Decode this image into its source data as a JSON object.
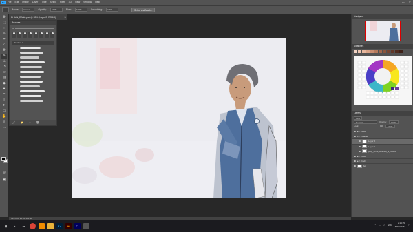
{
  "app": {
    "logo": "Ps",
    "menu": [
      "File",
      "Edit",
      "Image",
      "Layer",
      "Type",
      "Select",
      "Filter",
      "3D",
      "View",
      "Window",
      "Help"
    ],
    "window_controls": [
      "—",
      "▭",
      "✕"
    ]
  },
  "options_bar": {
    "mode_label": "Mode:",
    "mode_value": "Normal",
    "opacity_label": "Opacity:",
    "opacity_value": "100%",
    "flow_label": "Flow:",
    "flow_value": "100%",
    "smoothing_label": "Smoothing:",
    "smoothing_value": "10%",
    "select_mask_label": "Select and Mask..."
  },
  "document": {
    "tab_title": "DHAIN_DANA.psd @ 33% (Layer 2, RGB/8)",
    "close": "✕",
    "status": "33%   Doc: 24.3M/164.8M"
  },
  "brushes_panel": {
    "title": "Brushes",
    "size_value": "10",
    "folder_label": "Brushes 2",
    "preset_sizes": [
      "30",
      "30",
      "30",
      "25",
      "25",
      "36",
      "25",
      "36",
      "38"
    ],
    "footer": [
      "🖌",
      "📁",
      "+",
      "🗑"
    ]
  },
  "navigator": {
    "title": "Navigator"
  },
  "swatches_panel": {
    "title": "Swatches",
    "colors": [
      "#f2d3c4",
      "#efc7b2",
      "#e7b79e",
      "#d9a387",
      "#c98d70",
      "#b67a5c",
      "#a0674c",
      "#8b563d",
      "#774632",
      "#633828",
      "#502c1f",
      "#3e2118"
    ]
  },
  "layers_panel": {
    "title": "Layers",
    "kind_label": "Kind",
    "blend_mode": "Normal",
    "opacity_label": "Opacity:",
    "opacity_value": "100%",
    "lock_label": "Lock:",
    "fill_label": "Fill:",
    "fill_value": "100%",
    "layers": [
      {
        "name": "lines"
      },
      {
        "name": "shaded"
      },
      {
        "name": "Layer 2",
        "selected": true
      },
      {
        "name": "Layer 1"
      },
      {
        "name": "prog_arms_cleaned_&_mixed"
      },
      {
        "name": "face"
      },
      {
        "name": "body"
      },
      {
        "name": "bg"
      }
    ]
  },
  "taskbar": {
    "icons": [
      "start-icon",
      "search-icon",
      "taskview-icon",
      "chrome-icon",
      "vlc-icon",
      "files-icon",
      "photoshop-icon",
      "illustrator-icon",
      "premiere-icon",
      "explorer-icon"
    ],
    "language": "ENG",
    "time": "2:14 PM",
    "date": "2020-02-29"
  },
  "colors": {
    "ui_dark": "#535353",
    "ps_blue": "#31a8ff",
    "canvas": "#ececf1"
  }
}
